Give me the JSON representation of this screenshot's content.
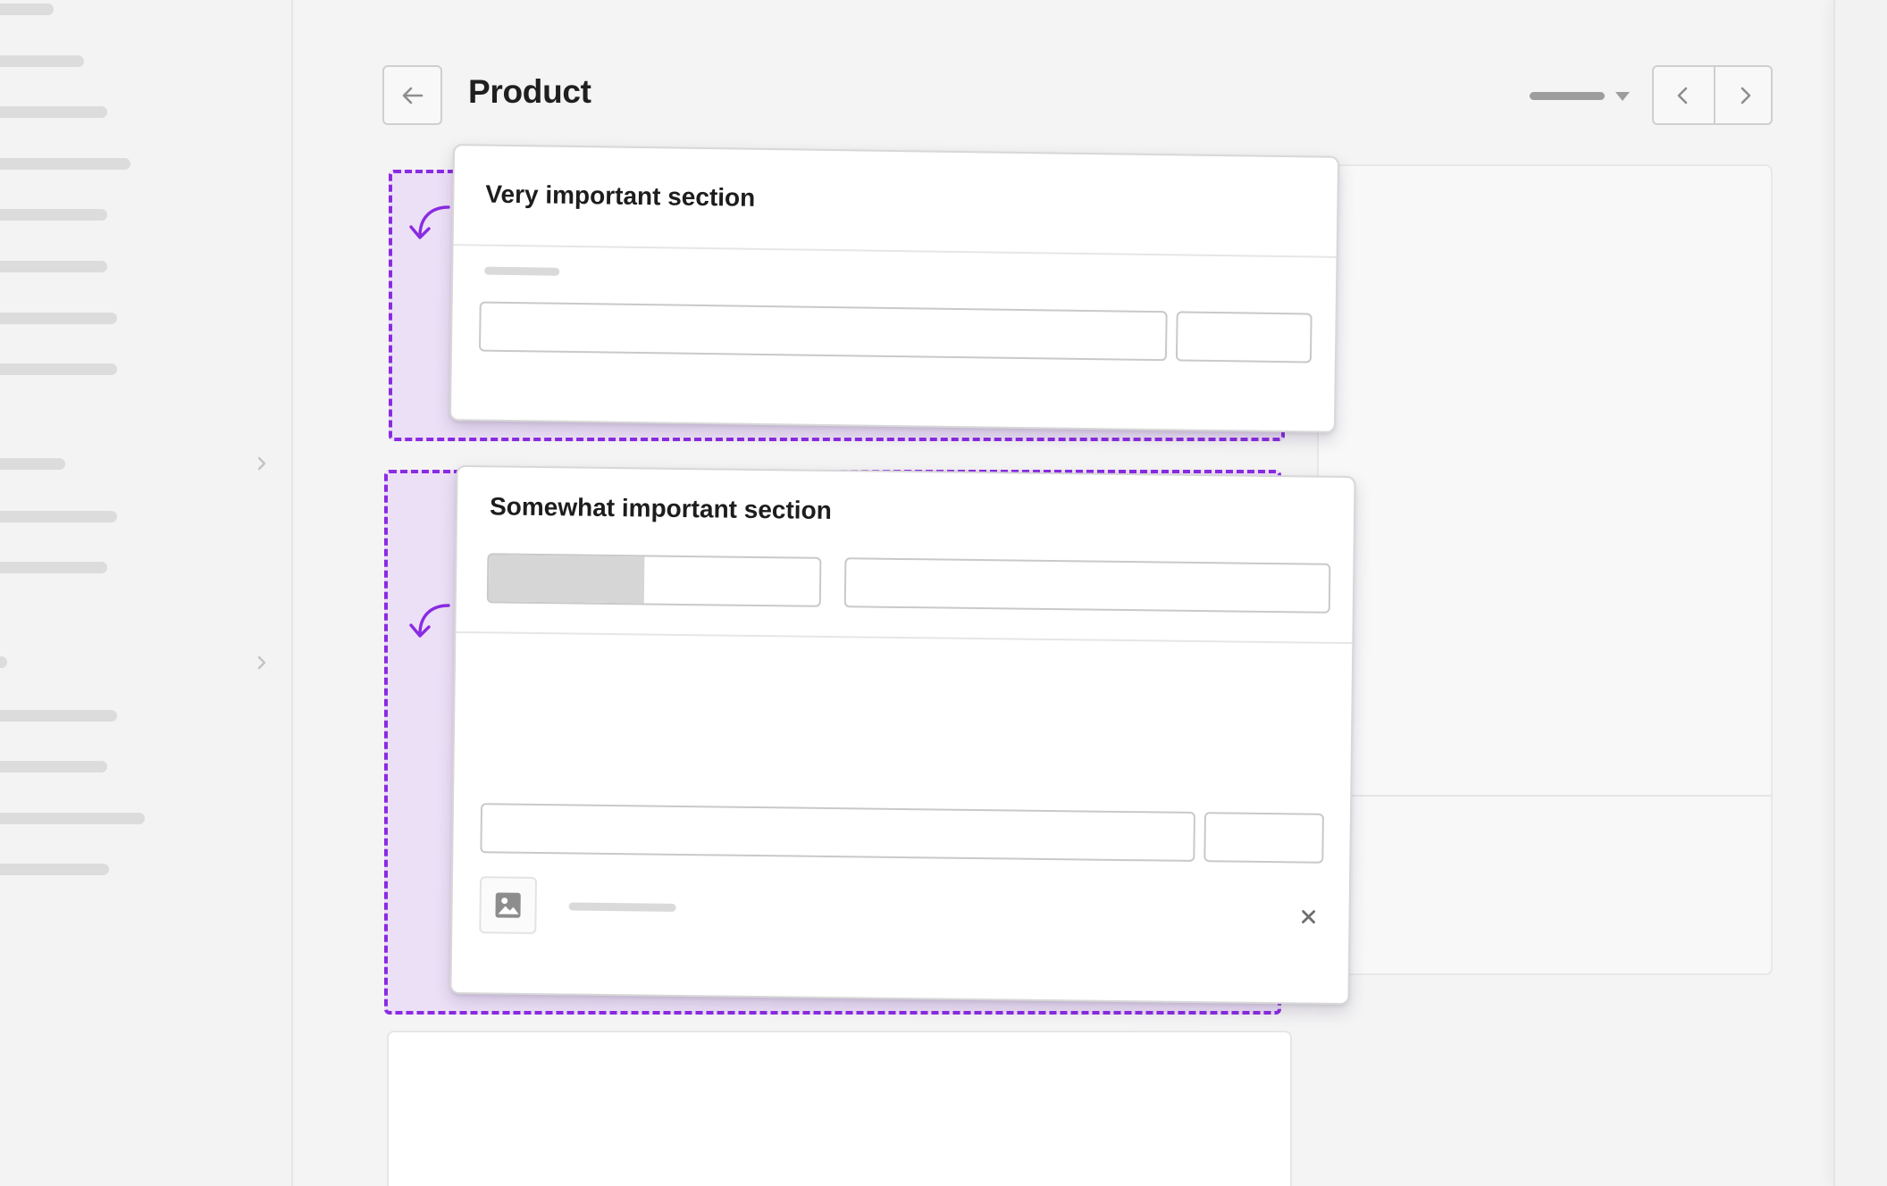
{
  "header": {
    "title": "Product",
    "back_icon": "arrow-left-icon",
    "prev_icon": "chevron-left-icon",
    "next_icon": "chevron-right-icon",
    "sort_caret_icon": "caret-down-icon"
  },
  "sections": [
    {
      "title": "Very important section"
    },
    {
      "title": "Somewhat important section"
    }
  ],
  "colors": {
    "accent": "#8a2be2",
    "drop_zone_fill": "#ece0f6",
    "page_bg": "#f4f4f4",
    "card_bg": "#ffffff"
  }
}
